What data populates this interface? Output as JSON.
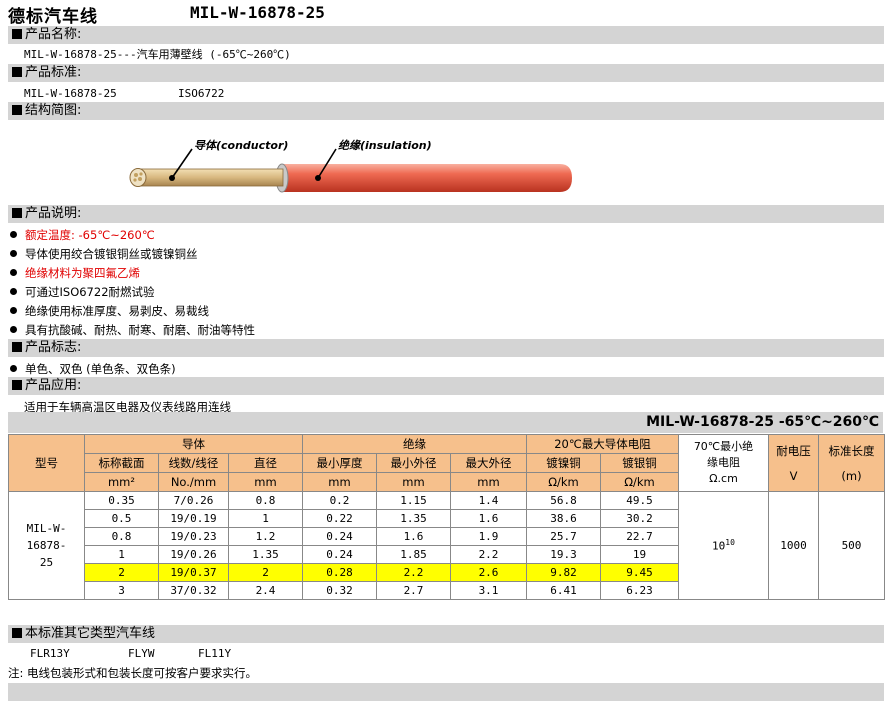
{
  "header": {
    "title": "德标汽车线",
    "code": "MIL-W-16878-25"
  },
  "sections": {
    "name": "产品名称:",
    "standard": "产品标准:",
    "structure": "结构简图:",
    "description": "产品说明:",
    "marking": "产品标志:",
    "application": "产品应用:",
    "other": "本标准其它类型汽车线"
  },
  "product_name": "MIL-W-16878-25---汽车用薄壁线 (-65℃~260℃)",
  "standards": [
    "MIL-W-16878-25",
    "ISO6722"
  ],
  "diagram": {
    "conductor_label": "导体(conductor)",
    "insulation_label": "绝缘(insulation)",
    "colors": {
      "insulation": "#e8604a",
      "conductor": "#d8b880",
      "strands": "#e8d8a8"
    }
  },
  "description_items": [
    {
      "text": "额定温度: -65℃~260℃",
      "red": true
    },
    {
      "text": "导体使用绞合镀银铜丝或镀镍铜丝",
      "red": false
    },
    {
      "text": "绝缘材料为聚四氟乙烯",
      "red": true
    },
    {
      "text": "可通过ISO6722耐燃试验",
      "red": false
    },
    {
      "text": "绝缘使用标准厚度、易剥皮、易裁线",
      "red": false
    },
    {
      "text": "具有抗酸碱、耐热、耐寒、耐磨、耐油等特性",
      "red": false
    }
  ],
  "marking_items": [
    "单色、双色 (单色条、双色条)"
  ],
  "application_text": "适用于车辆高温区电器及仪表线路用连线",
  "spec_title": "MIL-W-16878-25 -65℃~260℃",
  "table": {
    "headers": {
      "model": "型号",
      "conductor": "导体",
      "insulation": "绝缘",
      "resistance": "20℃最大导体电阻",
      "insulation_resistance": "70℃最小绝缘电阻",
      "voltage": "耐电压",
      "length": "标准长度",
      "area": "标称截面",
      "area_unit": "mm²",
      "strands": "线数/线径",
      "strands_unit": "No./mm",
      "diameter": "直径",
      "diameter_unit": "mm",
      "min_thickness": "最小厚度",
      "min_thickness_unit": "mm",
      "min_od": "最小外径",
      "min_od_unit": "mm",
      "max_od": "最大外径",
      "max_od_unit": "mm",
      "tin": "镀镍铜",
      "tin_unit": "Ω/km",
      "silver": "镀银铜",
      "silver_unit": "Ω/km",
      "ir_unit": "Ω.cm",
      "voltage_unit": "V",
      "length_unit": "(m)"
    },
    "model_name": "MIL-W-16878-25",
    "ir_value": "10",
    "ir_exp": "10",
    "voltage_value": "1000",
    "length_value": "500",
    "highlight_row": 4,
    "rows": [
      [
        "0.35",
        "7/0.26",
        "0.8",
        "0.2",
        "1.15",
        "1.4",
        "56.8",
        "49.5"
      ],
      [
        "0.5",
        "19/0.19",
        "1",
        "0.22",
        "1.35",
        "1.6",
        "38.6",
        "30.2"
      ],
      [
        "0.8",
        "19/0.23",
        "1.2",
        "0.24",
        "1.6",
        "1.9",
        "25.7",
        "22.7"
      ],
      [
        "1",
        "19/0.26",
        "1.35",
        "0.24",
        "1.85",
        "2.2",
        "19.3",
        "19"
      ],
      [
        "2",
        "19/0.37",
        "2",
        "0.28",
        "2.2",
        "2.6",
        "9.82",
        "9.45"
      ],
      [
        "3",
        "37/0.32",
        "2.4",
        "0.32",
        "2.7",
        "3.1",
        "6.41",
        "6.23"
      ]
    ]
  },
  "other_types": [
    "FLR13Y",
    "FLYW",
    "FL11Y"
  ],
  "note": "注: 电线包装形式和包装长度可按客户要求实行。"
}
